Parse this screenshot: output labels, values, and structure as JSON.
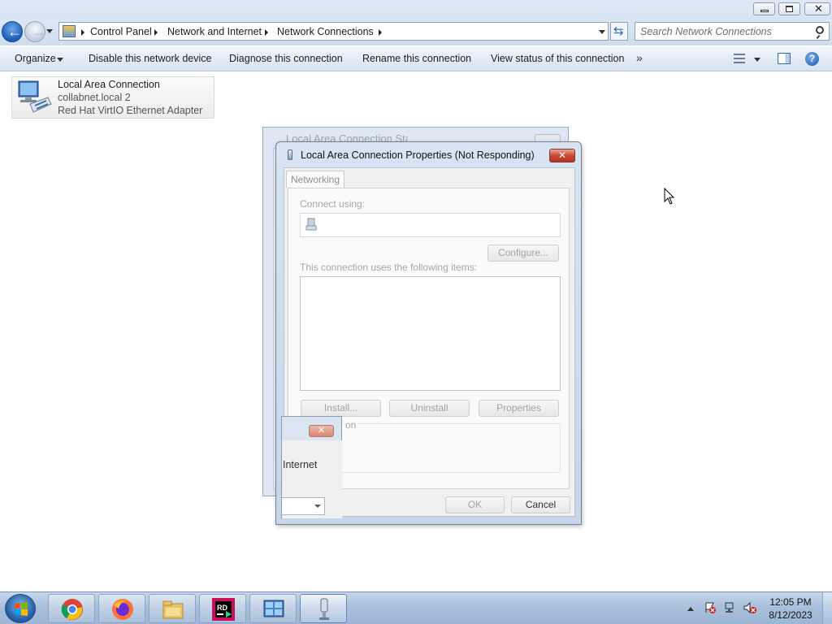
{
  "window": {
    "buttons": [
      "minimize",
      "restore",
      "close"
    ]
  },
  "navigation": {
    "breadcrumb": [
      "Control Panel",
      "Network and Internet",
      "Network Connections"
    ],
    "search_placeholder": "Search Network Connections"
  },
  "toolbar": {
    "organize": "Organize",
    "disable": "Disable this network device",
    "diagnose": "Diagnose this connection",
    "rename": "Rename this connection",
    "view_status": "View status of this connection",
    "more": "»"
  },
  "connection": {
    "name": "Local Area Connection",
    "network": "collabnet.local  2",
    "adapter": "Red Hat VirtIO Ethernet Adapter"
  },
  "status_window": {
    "title": "Local Area Connection Status"
  },
  "properties_dialog": {
    "title": "Local Area Connection Properties (Not Responding)",
    "tab": "Networking",
    "connect_using_label": "Connect using:",
    "configure_button": "Configure...",
    "items_label": "This connection uses the following items:",
    "install_button": "Install...",
    "uninstall_button": "Uninstall",
    "properties_button": "Properties",
    "description_fragment": "on",
    "ok_button": "OK",
    "cancel_button": "Cancel"
  },
  "popup": {
    "label": "Internet"
  },
  "taskbar": {
    "apps": [
      "chrome-icon",
      "firefox-icon",
      "file-explorer-icon",
      "rider-icon",
      "network-connections-icon",
      "network-properties-icon"
    ],
    "tray_icons": [
      "action-center-icon",
      "network-icon",
      "volume-muted-icon"
    ],
    "time": "12:05 PM",
    "date": "8/12/2023"
  }
}
